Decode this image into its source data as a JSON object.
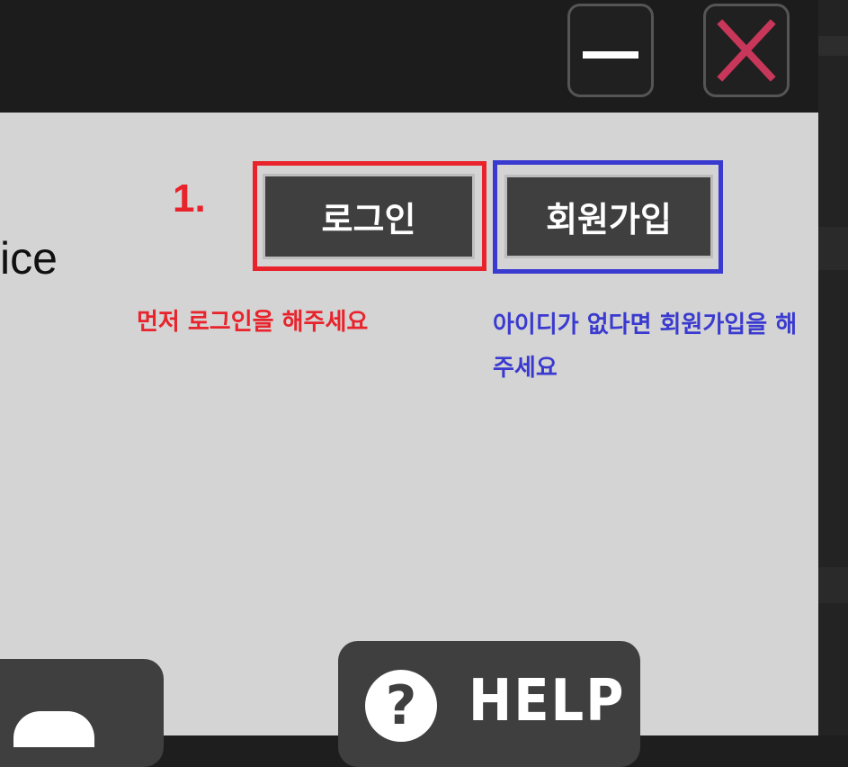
{
  "window": {
    "minimize_icon": "minimize-icon",
    "close_icon": "close-icon",
    "close_color": "#c8375a"
  },
  "main": {
    "title_fragment": "ice",
    "step_label": "1.",
    "login_button": "로그인",
    "signup_button": "회원가입",
    "login_hint": "먼저 로그인을 해주세요",
    "signup_hint": "아이디가 없다면 회원가입을 해주세요",
    "help_label": "HELP",
    "help_icon": "?"
  },
  "colors": {
    "annotation_red": "#e8232b",
    "annotation_blue": "#3a3ad0",
    "button_bg": "#3f3f3f",
    "panel_bg": "#d4d4d4"
  }
}
